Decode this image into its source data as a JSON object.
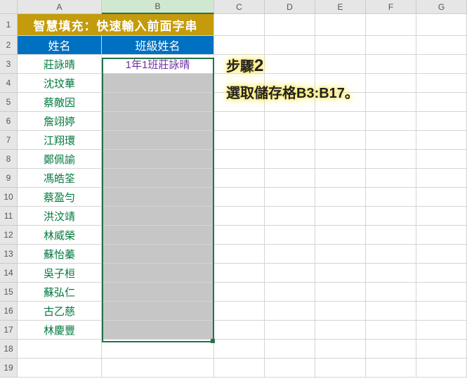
{
  "columns": [
    "A",
    "B",
    "C",
    "D",
    "E",
    "F",
    "G"
  ],
  "rowNumbers": [
    1,
    2,
    3,
    4,
    5,
    6,
    7,
    8,
    9,
    10,
    11,
    12,
    13,
    14,
    15,
    16,
    17,
    18,
    19
  ],
  "title": "智慧填充：快速輸入前面字串",
  "headers": {
    "a": "姓名",
    "b": "班級姓名"
  },
  "names": [
    "莊詠晴",
    "沈玟華",
    "蔡敵因",
    "詹翊婷",
    "江翔環",
    "鄭佩諭",
    "馮皓筌",
    "蔡盈勻",
    "洪汶靖",
    "林威榮",
    "蘇怡蓁",
    "吳子桓",
    "蘇弘仁",
    "古乙慈",
    "林慶豐"
  ],
  "b3": "1年1班莊詠晴",
  "annotation": {
    "stepLabel": "步驟",
    "stepNum": "2",
    "text": "選取儲存格B3:B17。"
  },
  "chart_data": {
    "type": "table",
    "title": "智慧填充：快速輸入前面字串",
    "columns": [
      "姓名",
      "班級姓名"
    ],
    "rows": [
      [
        "莊詠晴",
        "1年1班莊詠晴"
      ],
      [
        "沈玟華",
        ""
      ],
      [
        "蔡敵因",
        ""
      ],
      [
        "詹翊婷",
        ""
      ],
      [
        "江翔環",
        ""
      ],
      [
        "鄭佩諭",
        ""
      ],
      [
        "馮皓筌",
        ""
      ],
      [
        "蔡盈勻",
        ""
      ],
      [
        "洪汶靖",
        ""
      ],
      [
        "林威榮",
        ""
      ],
      [
        "蘇怡蓁",
        ""
      ],
      [
        "吳子桓",
        ""
      ],
      [
        "蘇弘仁",
        ""
      ],
      [
        "古乙慈",
        ""
      ],
      [
        "林慶豐",
        ""
      ]
    ],
    "selection": "B3:B17"
  }
}
